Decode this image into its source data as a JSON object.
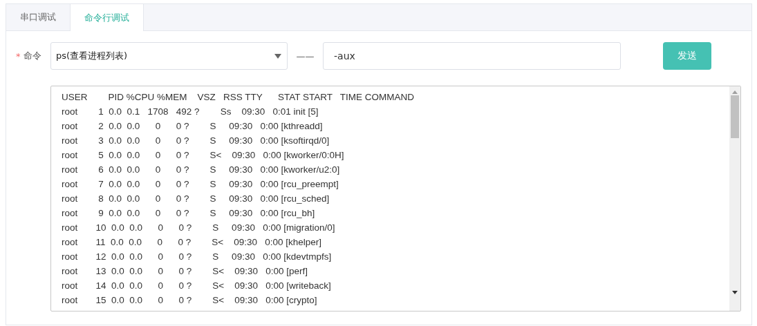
{
  "tabs": [
    {
      "label": "串口调试",
      "selected": false
    },
    {
      "label": "命令行调试",
      "selected": true
    }
  ],
  "form": {
    "label": "命令",
    "required_mark": "*",
    "command": "ps(查看进程列表)",
    "separator": "——",
    "args": "-aux",
    "send_button": "发送"
  },
  "output": {
    "lines": [
      "USER        PID %CPU %MEM    VSZ   RSS TTY      STAT START   TIME COMMAND",
      "root        1  0.0  0.1   1708   492 ?        Ss    09:30   0:01 init [5]",
      "root        2  0.0  0.0      0      0 ?        S     09:30   0:00 [kthreadd]",
      "root        3  0.0  0.0      0      0 ?        S     09:30   0:00 [ksoftirqd/0]",
      "root        5  0.0  0.0      0      0 ?        S<    09:30   0:00 [kworker/0:0H]",
      "root        6  0.0  0.0      0      0 ?        S     09:30   0:00 [kworker/u2:0]",
      "root        7  0.0  0.0      0      0 ?        S     09:30   0:00 [rcu_preempt]",
      "root        8  0.0  0.0      0      0 ?        S     09:30   0:00 [rcu_sched]",
      "root        9  0.0  0.0      0      0 ?        S     09:30   0:00 [rcu_bh]",
      "root       10  0.0  0.0      0      0 ?        S     09:30   0:00 [migration/0]",
      "root       11  0.0  0.0      0      0 ?        S<    09:30   0:00 [khelper]",
      "root       12  0.0  0.0      0      0 ?        S     09:30   0:00 [kdevtmpfs]",
      "root       13  0.0  0.0      0      0 ?        S<    09:30   0:00 [perf]",
      "root       14  0.0  0.0      0      0 ?        S<    09:30   0:00 [writeback]",
      "root       15  0.0  0.0      0      0 ?        S<    09:30   0:00 [crypto]"
    ]
  }
}
